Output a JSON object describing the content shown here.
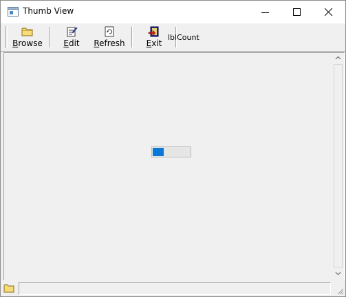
{
  "window": {
    "title": "Thumb View"
  },
  "titlebar": {
    "app_icon": "window-app-icon",
    "minimize_icon": "minimize-icon",
    "maximize_icon": "maximize-icon",
    "close_icon": "close-icon"
  },
  "toolbar": {
    "buttons": [
      {
        "label": "Browse",
        "mnemonic": "B",
        "rest": "rowse",
        "icon": "folder-icon"
      },
      {
        "label": "Edit",
        "mnemonic": "E",
        "rest": "dit",
        "icon": "edit-icon"
      },
      {
        "label": "Refresh",
        "mnemonic": "R",
        "rest": "efresh",
        "icon": "refresh-icon"
      },
      {
        "label": "Exit",
        "mnemonic": "E",
        "rest": "xit",
        "icon": "exit-icon"
      }
    ],
    "count_label": "lblCount"
  },
  "progress": {
    "value_fraction": 0.3,
    "fill_color": "#0a78d7"
  },
  "statusbar": {
    "icon": "folder-icon",
    "text": ""
  }
}
